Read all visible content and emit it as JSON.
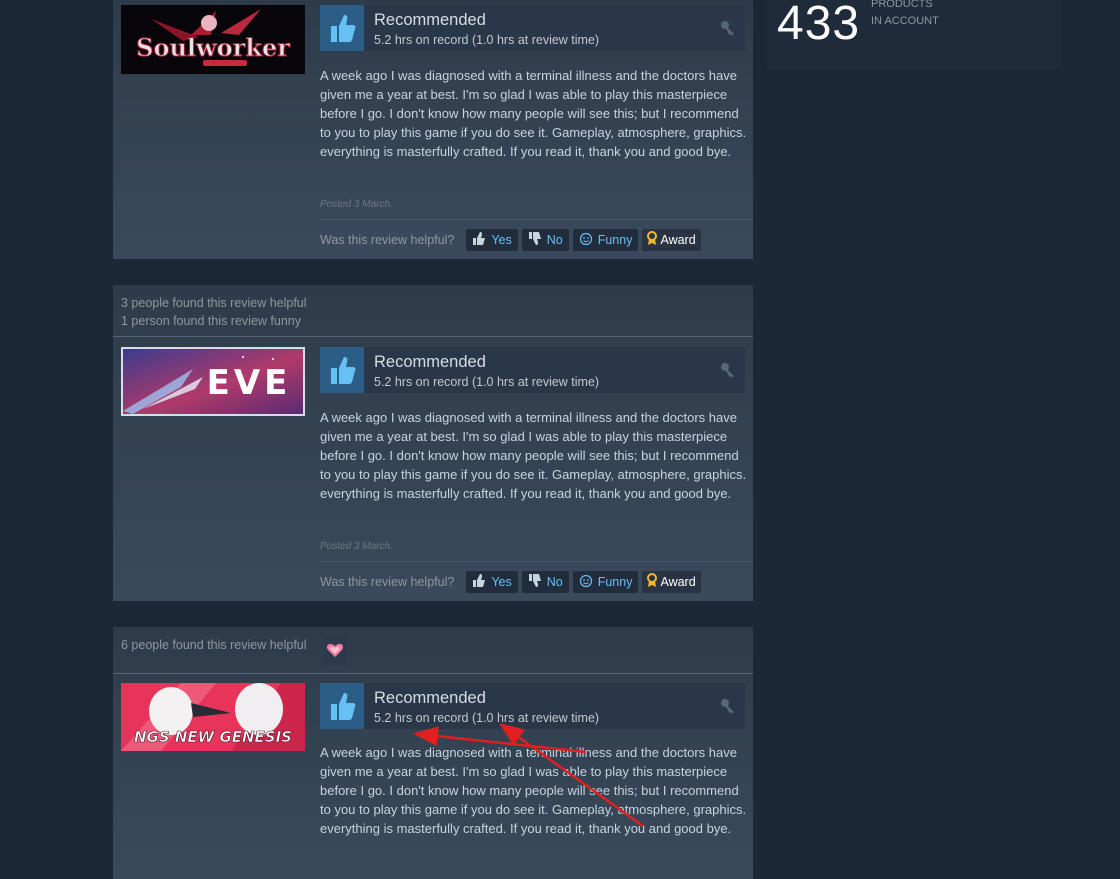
{
  "sidebar": {
    "products_count": "433",
    "products_label": "PRODUCTS",
    "in_account_label": "IN ACCOUNT"
  },
  "reviews": [
    {
      "game_logo_text": "Soulworker",
      "vote": "Recommended",
      "hours": "5.2 hrs on record (1.0 hrs at review time)",
      "text": "A week ago I was diagnosed with a terminal illness and the doctors have given me a year at best. I'm so glad I was able to play this masterpiece before I go. I don't know how many people will see this; but I recommend to you to play this game if you do see it. Gameplay, atmosphere, graphics. everything is masterfully crafted. If you read it, thank you and good bye.",
      "posted": "Posted 3 March.",
      "helpful_question": "Was this review helpful?",
      "btn_yes": "Yes",
      "btn_no": "No",
      "btn_funny": "Funny",
      "btn_award": "Award"
    },
    {
      "helpful_count": "3 people found this review helpful",
      "funny_count": "1 person found this review funny",
      "game_logo_text": "EVE",
      "vote": "Recommended",
      "hours": "5.2 hrs on record (1.0 hrs at review time)",
      "text": "A week ago I was diagnosed with a terminal illness and the doctors have given me a year at best. I'm so glad I was able to play this masterpiece before I go. I don't know how many people will see this; but I recommend to you to play this game if you do see it. Gameplay, atmosphere, graphics. everything is masterfully crafted. If you read it, thank you and good bye.",
      "posted": "Posted 3 March.",
      "helpful_question": "Was this review helpful?",
      "btn_yes": "Yes",
      "btn_no": "No",
      "btn_funny": "Funny",
      "btn_award": "Award"
    },
    {
      "helpful_count": "6 people found this review helpful",
      "game_logo_text": "NGS NEW GENESIS",
      "vote": "Recommended",
      "hours": "5.2 hrs on record (1.0 hrs at review time)",
      "text": "A week ago I was diagnosed with a terminal illness and the doctors have given me a year at best. I'm so glad I was able to play this masterpiece before I go. I don't know how many people will see this; but I recommend to you to play this game if you do see it. Gameplay, atmosphere, graphics. everything is masterfully crafted. If you read it, thank you and good bye."
    }
  ],
  "colors": {
    "page_bg": "#1b2838",
    "thumb_bg": "#2c5d86",
    "link": "#66c0f4",
    "annotation_arrow": "#e02020"
  },
  "icons": {
    "thumbs_up": "thumbs-up-icon",
    "key": "key-icon",
    "yes": "thumbs-up-small-icon",
    "no": "thumbs-down-small-icon",
    "funny": "smiley-icon",
    "award": "award-ribbon-icon",
    "badge": "heart-award-icon"
  }
}
